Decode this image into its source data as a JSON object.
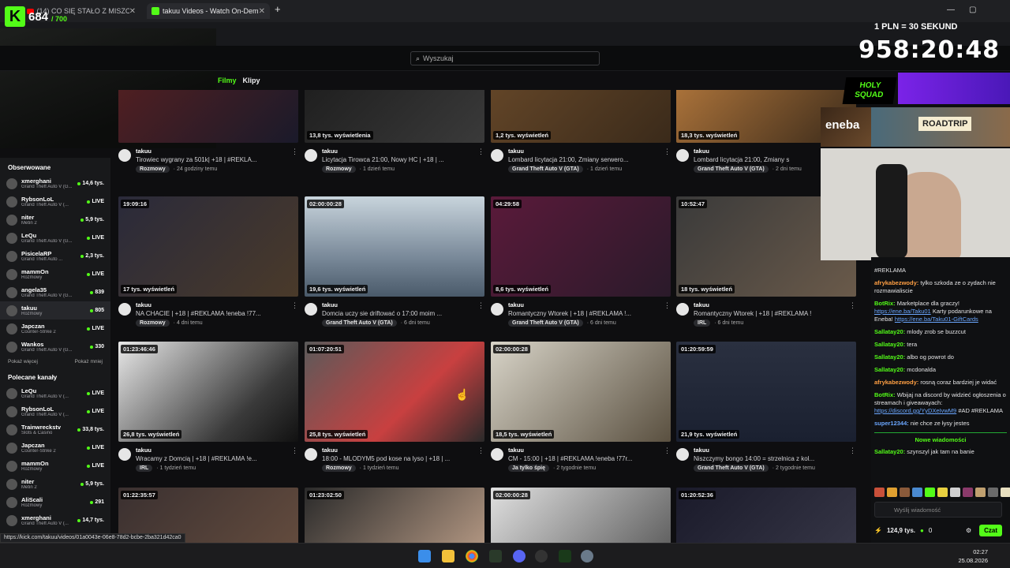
{
  "browser": {
    "tabs": [
      {
        "label": "(14) CO SIĘ STAŁO Z MISZCZEM",
        "active": false
      },
      {
        "label": "takuu Videos - Watch On-Dem",
        "active": true
      }
    ],
    "new_tab": "+",
    "status_url": "https://kick.com/takuu/videos/01a0043e-06e8-78d2-bcbe-2ba321d42ca0"
  },
  "overlay": {
    "counter": "684",
    "counter_max": "/ 700",
    "rate": "1 PLN = 30 SEKUND",
    "timer": "958:20:48",
    "sponsor": "eneba",
    "sponsor_badge": "HOLY SQUAD",
    "roadtrip": "ROADTRIP"
  },
  "search": {
    "placeholder": "Wyszukaj"
  },
  "filters": {
    "films": "Filmy",
    "clips": "Klipy"
  },
  "sidebar": {
    "followed_title": "Obserwowane",
    "followed": [
      {
        "name": "xmerghani",
        "category": "Grand Theft Auto V (G...",
        "live": "14,6 tys."
      },
      {
        "name": "RybsonLoL",
        "category": "Grand Theft Auto V (...",
        "live": "LIVE"
      },
      {
        "name": "niter",
        "category": "Metin 2",
        "live": "5,9 tys."
      },
      {
        "name": "LeQu",
        "category": "Grand Theft Auto V (G...",
        "live": "LIVE"
      },
      {
        "name": "PisicelaRP",
        "category": "Grand Theft Auto ...",
        "live": "2,3 tys."
      },
      {
        "name": "mammOn",
        "category": "Rozmowy",
        "live": "LIVE"
      },
      {
        "name": "angela35",
        "category": "Grand Theft Auto V (G...",
        "live": "839"
      },
      {
        "name": "takuu",
        "category": "Rozmowy",
        "live": "805"
      },
      {
        "name": "Japczan",
        "category": "Counter-Strike 2",
        "live": "LIVE"
      },
      {
        "name": "Wankos",
        "category": "Grand Theft Auto V (G...",
        "live": "330"
      }
    ],
    "show_more": "Pokaż więcej",
    "show_less": "Pokaż mniej",
    "recommended_title": "Polecane kanały",
    "recommended": [
      {
        "name": "LeQu",
        "category": "Grand Theft Auto V (...",
        "live": "LIVE"
      },
      {
        "name": "RybsonLoL",
        "category": "Grand Theft Auto V (...",
        "live": "LIVE"
      },
      {
        "name": "Trainwreckstv",
        "category": "Slots & Casino",
        "live": "33,8 tys."
      },
      {
        "name": "Japczan",
        "category": "Counter-Strike 2",
        "live": "LIVE"
      },
      {
        "name": "mammOn",
        "category": "Rozmowy",
        "live": "LIVE"
      },
      {
        "name": "niter",
        "category": "Metin 2",
        "live": "5,9 tys."
      },
      {
        "name": "AliScali",
        "category": "Rozmowy",
        "live": "291"
      },
      {
        "name": "xmerghani",
        "category": "Grand Theft Auto V (...",
        "live": "14,7 tys."
      }
    ]
  },
  "videos": [
    {
      "duration": "",
      "views": "",
      "channel": "takuu",
      "title": "Tirowiec wygrany za 501k| +18 | #REKLA...",
      "category": "Rozmowy",
      "ago": "24 godziny temu"
    },
    {
      "duration": "",
      "views": "13,8 tys. wyświetlenia",
      "channel": "takuu",
      "title": "Licytacja Tirowca 21:00, Nowy HC | +18 | ...",
      "category": "Rozmowy",
      "ago": "1 dzień temu"
    },
    {
      "duration": "",
      "views": "1,2 tys. wyświetleń",
      "channel": "takuu",
      "title": "Lombard licytacja 21:00, Zmiany serwero...",
      "category": "Grand Theft Auto V (GTA)",
      "ago": "1 dzień temu"
    },
    {
      "duration": "",
      "views": "18,3 tys. wyświetleń",
      "channel": "takuu",
      "title": "Lombard licytacja 21:00, Zmiany s",
      "category": "Grand Theft Auto V (GTA)",
      "ago": "2 dni temu"
    },
    {
      "duration": "19:09:16",
      "views": "17 tys. wyświetleń",
      "channel": "takuu",
      "title": "NA CHACIE | +18 | #REKLAMA !eneba !77...",
      "category": "Rozmowy",
      "ago": "4 dni temu"
    },
    {
      "duration": "02:00:00:28",
      "views": "19,6 tys. wyświetleń",
      "channel": "takuu",
      "title": "Domcia uczy sie driftować o 17:00 moim ...",
      "category": "Grand Theft Auto V (GTA)",
      "ago": "6 dni temu"
    },
    {
      "duration": "04:29:58",
      "views": "8,6 tys. wyświetleń",
      "channel": "takuu",
      "title": "Romantyczny Wtorek | +18 | #REKLAMA !...",
      "category": "Grand Theft Auto V (GTA)",
      "ago": "6 dni temu"
    },
    {
      "duration": "10:52:47",
      "views": "18 tys. wyświetleń",
      "channel": "takuu",
      "title": "Romantyczny Wtorek | +18 | #REKLAMA !",
      "category": "IRL",
      "ago": "6 dni temu"
    },
    {
      "duration": "01:23:46:46",
      "views": "26,8 tys. wyświetleń",
      "channel": "takuu",
      "title": "Wracamy z Domcią | +18 | #REKLAMA !e...",
      "category": "IRL",
      "ago": "1 tydzień temu"
    },
    {
      "duration": "01:07:20:51",
      "views": "25,8 tys. wyświetleń",
      "channel": "takuu",
      "title": "18:00 - MLODYM5 pod kose na lyso | +18 | ...",
      "category": "Rozmowy",
      "ago": "1 tydzień temu"
    },
    {
      "duration": "02:00:00:28",
      "views": "18,5 tys. wyświetleń",
      "channel": "takuu",
      "title": "CM - 15:00 | +18 | #REKLAMA !eneba !77r...",
      "category": "Ja tylko śpię",
      "ago": "2 tygodnie temu"
    },
    {
      "duration": "01:20:59:59",
      "views": "21,9 tys. wyświetleń",
      "channel": "takuu",
      "title": "Niszczymy bongo 14:00 = strzelnica z kol...",
      "category": "Grand Theft Auto V (GTA)",
      "ago": "2 tygodnie temu"
    },
    {
      "duration": "01:22:35:57",
      "views": "",
      "channel": "",
      "title": "",
      "category": "",
      "ago": ""
    },
    {
      "duration": "01:23:02:50",
      "views": "",
      "channel": "",
      "title": "",
      "category": "",
      "ago": ""
    },
    {
      "duration": "02:00:00:28",
      "views": "",
      "channel": "",
      "title": "",
      "category": "",
      "ago": ""
    },
    {
      "duration": "01:20:52:36",
      "views": "",
      "channel": "",
      "title": "",
      "category": "",
      "ago": ""
    }
  ],
  "chat": {
    "top_fragment": "#REKLAMA",
    "messages": [
      {
        "user": "afrykabezwody:",
        "color": "#ff9f43",
        "text": "tylko szkoda ze o zydach nie rozmawialiscie"
      },
      {
        "user": "BotRix:",
        "color": "#53fc18",
        "text": "Marketplace dla graczy!",
        "link": "https://ene.ba/Taku01",
        "text2": "Karty podarunkowe na Eneba!",
        "link2": "https://ene.ba/Taku01-GiftCards"
      },
      {
        "user": "Sallatay20:",
        "color": "#53fc18",
        "text": "mlody zrob se buzzcut"
      },
      {
        "user": "Sallatay20:",
        "color": "#53fc18",
        "text": "tera"
      },
      {
        "user": "Sallatay20:",
        "color": "#53fc18",
        "text": "albo og powrot do"
      },
      {
        "user": "Sallatay20:",
        "color": "#53fc18",
        "text": "mcdonalda"
      },
      {
        "user": "afrykabezwody:",
        "color": "#ff9f43",
        "text": "rosną coraz bardziej je widać"
      },
      {
        "user": "BotRix:",
        "color": "#53fc18",
        "text": "Wbijaj na discord by widzieć ogłoszenia o streamach i giveawayach:",
        "link": "https://discord.gg/YyDXeIvwM9",
        "text2": "#AD #REKLAMA"
      },
      {
        "user": "super12344:",
        "color": "#6ba7ff",
        "text": "nie chce ze łysy jestes"
      }
    ],
    "new_messages": "Nowe wiadomości",
    "last": {
      "user": "Sallatay20:",
      "color": "#53fc18",
      "text": "szynszyl jak tam na banie"
    },
    "input_placeholder": "Wyślij wiadomość",
    "viewers": "124,9 tys.",
    "points": "0",
    "send": "Czat"
  },
  "taskbar": {
    "time": "02:27",
    "date": "25.08.2026"
  }
}
